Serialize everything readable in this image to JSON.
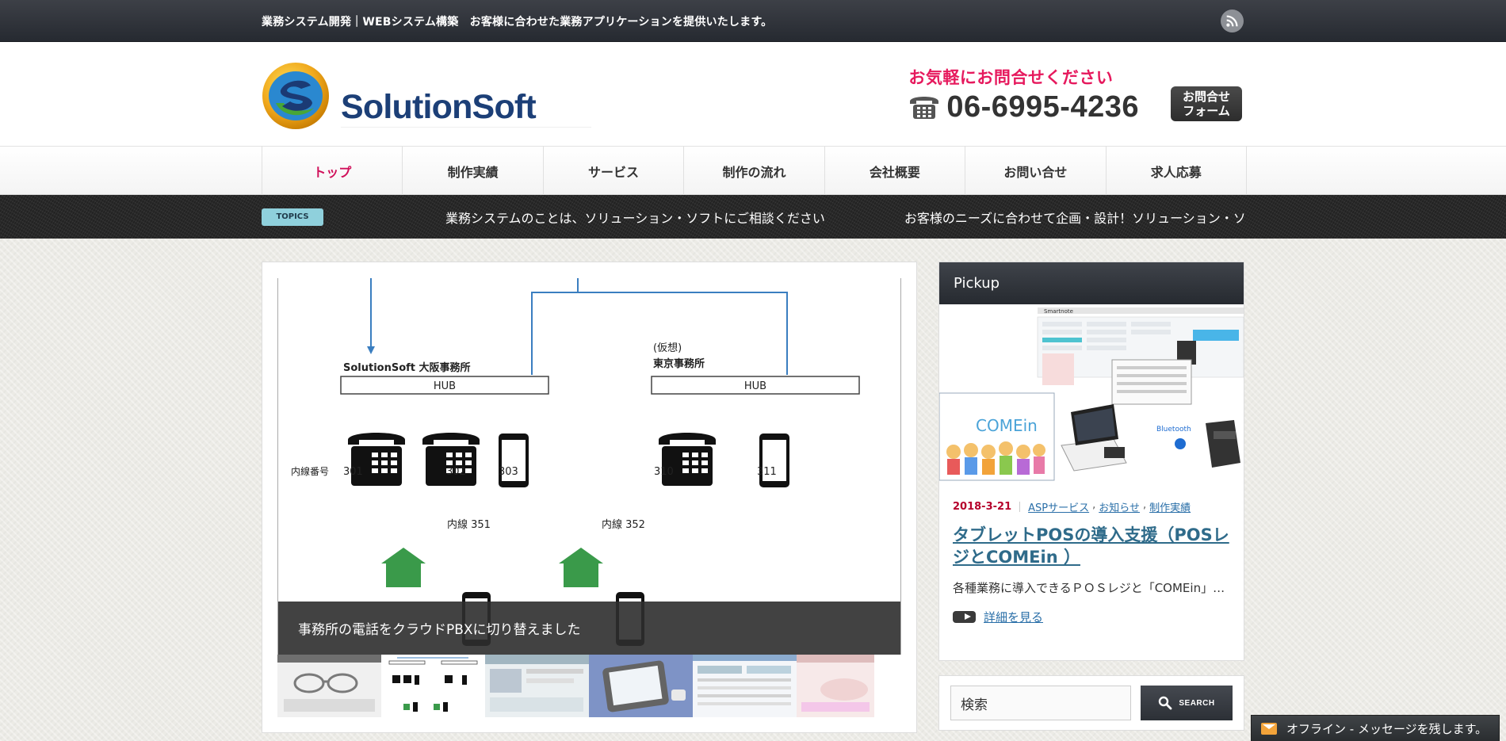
{
  "topbar": {
    "tagline": "業務システム開発｜WEBシステム構築　お客様に合わせた業務アプリケーションを提供いたします。",
    "rss_icon": "rss-icon"
  },
  "header": {
    "logo_text": "SolutionSoft",
    "contact_message": "お気軽にお問合せください",
    "phone": "06-6995-4236",
    "contact_button_line1": "お問合せ",
    "contact_button_line2": "フォーム"
  },
  "nav": {
    "items": [
      {
        "label": "トップ"
      },
      {
        "label": "制作実績"
      },
      {
        "label": "サービス"
      },
      {
        "label": "制作の流れ"
      },
      {
        "label": "会社概要"
      },
      {
        "label": "お問い合せ"
      },
      {
        "label": "求人応募"
      }
    ]
  },
  "topics": {
    "badge": "TOPICS",
    "items": [
      "業務システムのことは、ソリューション・ソフトにご相談ください",
      "お客様のニーズに合わせて企画・設計！ソリューション・ソフトの制"
    ]
  },
  "slider": {
    "caption": "事務所の電話をクラウドPBXに切り替えました",
    "diagram": {
      "office1_name": "SolutionSoft 大阪事務所",
      "office2_tag": "(仮想)",
      "office2_name": "東京事務所",
      "hub_label": "HUB",
      "ext_label": "内線番号",
      "ext_numbers": [
        "301",
        "302",
        "303",
        "310",
        "311"
      ],
      "ext_351": "内線 351",
      "ext_352": "内線 352"
    }
  },
  "pickup": {
    "heading": "Pickup",
    "image_text_brand": "Smartnote",
    "image_text_comein": "COMEin",
    "image_text_bt": "Bluetooth",
    "date": "2018-3-21",
    "categories": [
      "ASPサービス",
      "お知らせ",
      "制作実績"
    ],
    "title": "タブレットPOSの導入支援（POSレジとCOMEin ）",
    "excerpt": "各種業務に導入できるＰＯＳレジと「COMEin」…",
    "readmore": "詳細を見る"
  },
  "search": {
    "value": "検索",
    "button": "SEARCH"
  },
  "chat": {
    "label": "オフライン - メッセージを残します。"
  },
  "colors": {
    "accent_pink": "#e6195d",
    "nav_active": "#d0105a",
    "link_blue": "#2a6fa8",
    "date_red": "#b5002b",
    "topics_badge": "#8fd0dc"
  }
}
